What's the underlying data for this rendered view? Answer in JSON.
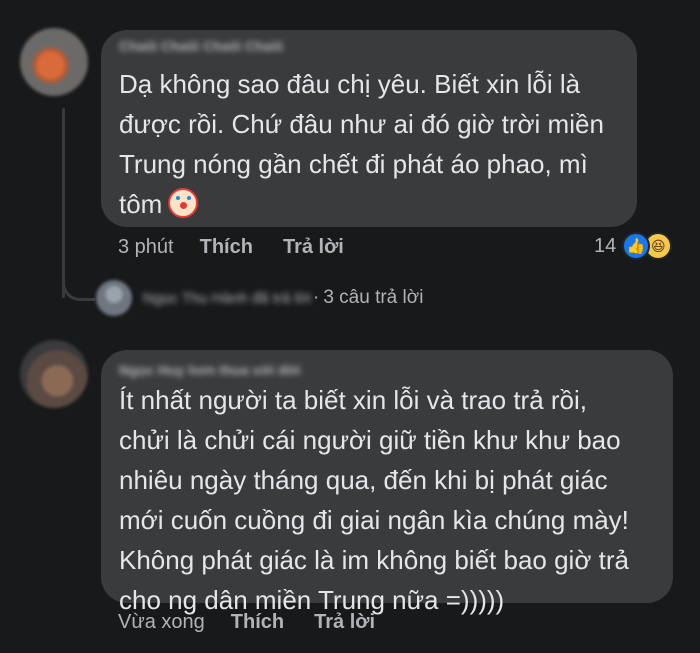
{
  "comment1": {
    "author_blurred": "Chaiii Chaiii Chaiii Chaiii",
    "text": "Dạ không sao đâu chị yêu. Biết xin lỗi là\nđược rồi. Chứ đâu như ai đó giờ trời miền\nTrung nóng gần chết đi phát áo phao, mì\ntôm",
    "emoji": "clown-face",
    "time": "3 phút",
    "like_label": "Thích",
    "reply_label": "Trả lời",
    "reaction_count": "14",
    "reactions": [
      "like",
      "haha"
    ]
  },
  "replies": {
    "author_blurred": "Ngọc Thu Hành đã trả lời",
    "separator": "·",
    "count_text": "3 câu trả lời"
  },
  "comment2": {
    "author_blurred": "Ngọc Huy hơn thua với đời",
    "text": "Ít nhất người ta biết xin lỗi và trao trả rồi,\nchửi là chửi cái người giữ tiền khư khư bao\nnhiêu ngày tháng qua, đến khi bị phát giác\nmới cuốn cuồng đi giai ngân kìa chúng mày!\nKhông phát giác là im không biết bao giờ trả\ncho ng dân miền Trung nữa =)))))",
    "time": "Vừa xong",
    "like_label": "Thích",
    "reply_label": "Trả lời"
  },
  "colors": {
    "background": "#18191a",
    "bubble": "#3a3b3c",
    "text": "#e4e6eb",
    "secondary_text": "#b0b3b8",
    "like_blue": "#1877f2"
  }
}
